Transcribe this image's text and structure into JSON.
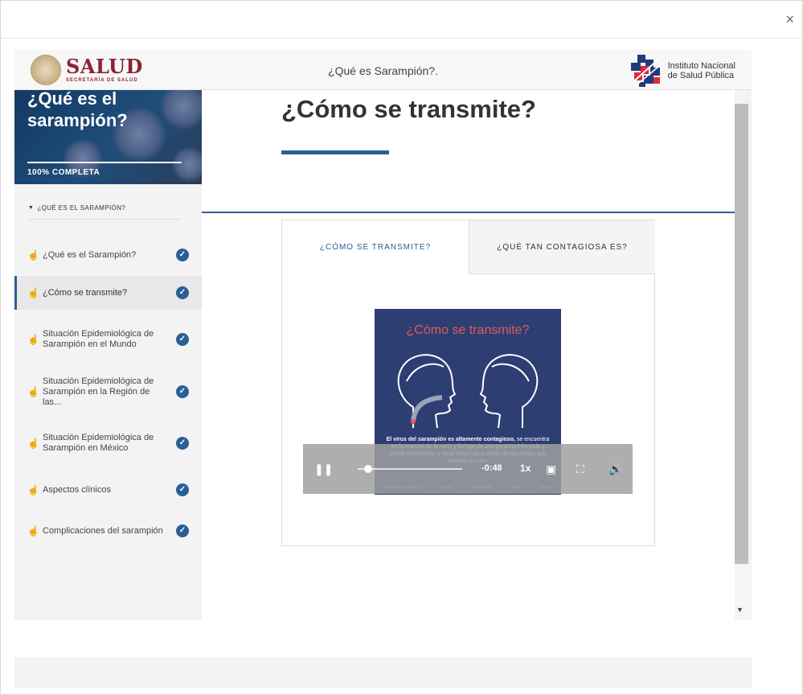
{
  "modal": {
    "close_label": "×"
  },
  "header": {
    "logo_title": "SALUD",
    "logo_subtitle": "SECRETARÍA DE SALUD",
    "title": "¿Qué es Sarampión?.",
    "institute_line1": "Instituto Nacional",
    "institute_line2": "de Salud Pública"
  },
  "sidebar": {
    "hero_title_line1": "¿Qué es el",
    "hero_title_line2": "sarampión?",
    "progress": "100% COMPLETA",
    "section_label": "¿QUÉ ES EL SARAMPIÓN?",
    "items": [
      {
        "label": "¿Qué es el Sarampión?"
      },
      {
        "label": "¿Cómo se transmite?"
      },
      {
        "label": "Situación Epidemiológica de Sarampión en el Mundo"
      },
      {
        "label": "Situación Epidemiológica de Sarampión en la Región de las..."
      },
      {
        "label": "Situación Epidemiológica de Sarampión en México"
      },
      {
        "label": "Aspectos clínicos"
      },
      {
        "label": "Complicaciones del sarampión"
      }
    ]
  },
  "lesson": {
    "title": "¿Cómo se transmite?",
    "tabs": [
      {
        "label": "¿CÓMO SE TRANSMITE?"
      },
      {
        "label": "¿QUÉ TAN CONTAGIOSA ES?"
      }
    ],
    "video": {
      "title": "¿Cómo se transmite?",
      "caption_bold": "El virus del sarampión es altamente contagioso,",
      "caption_rest": "se encuentra en la mucosa de la nariz y faringe de una persona infectada y puede transmitirse a otras personas a través de las gotitas que expulsa al toser",
      "footer_logos": [
        "GOBIERNO DE MÉXICO",
        "SALUD",
        "SECRETARÍA",
        "INSP",
        "CENSIA"
      ],
      "time": "-0:48",
      "rate": "1x"
    }
  }
}
